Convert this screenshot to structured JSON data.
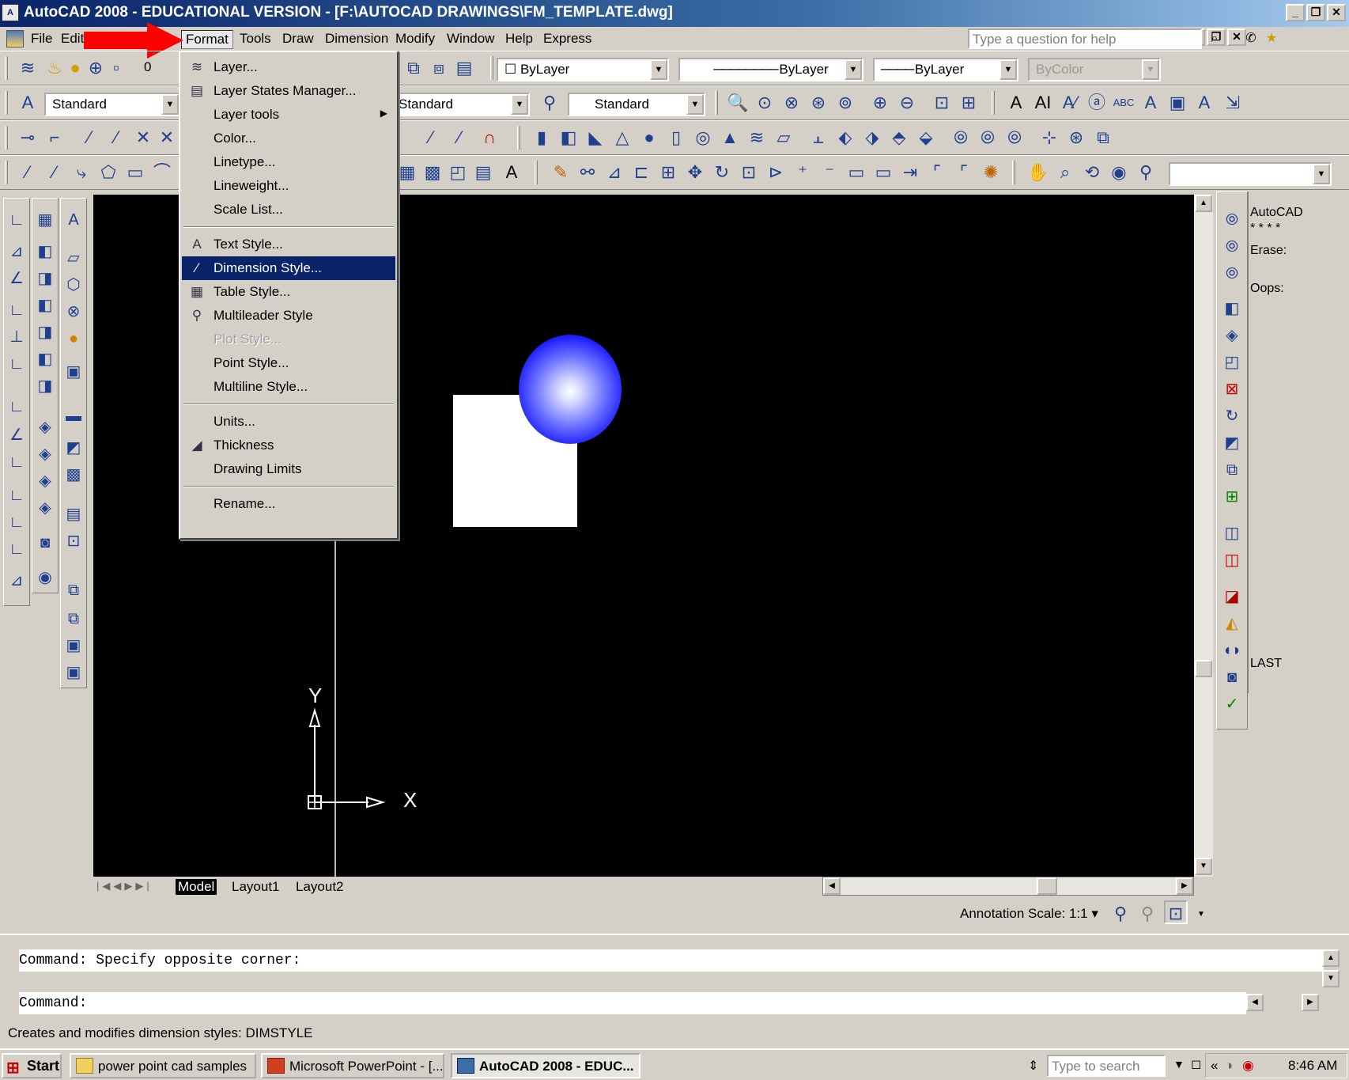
{
  "window": {
    "title": "AutoCAD 2008 - EDUCATIONAL VERSION - [F:\\AUTOCAD DRAWINGS\\FM_TEMPLATE.dwg]",
    "app_icon": "autocad-icon"
  },
  "menubar": {
    "items": [
      {
        "label": "File"
      },
      {
        "label": "Edit"
      },
      {
        "label": "Format"
      },
      {
        "label": "Tools"
      },
      {
        "label": "Draw"
      },
      {
        "label": "Dimension"
      },
      {
        "label": "Modify"
      },
      {
        "label": "Window"
      },
      {
        "label": "Help"
      },
      {
        "label": "Express"
      }
    ],
    "active": "Format",
    "help_placeholder": "Type a question for help"
  },
  "toolbars": {
    "layer_value": "0",
    "color_combo": "ByLayer",
    "linetype_combo": "ByLayer",
    "lineweight_combo": "ByLayer",
    "plotstyle_combo": "ByColor",
    "text_style": "Standard",
    "dim_style": "Standard",
    "table_style": "Standard"
  },
  "format_menu": {
    "items": [
      {
        "label": "Layer...",
        "icon": "layer-icon"
      },
      {
        "label": "Layer States Manager...",
        "icon": "layer-states-icon"
      },
      {
        "label": "Layer tools",
        "submenu": true
      },
      {
        "label": "Color..."
      },
      {
        "label": "Linetype..."
      },
      {
        "label": "Lineweight..."
      },
      {
        "label": "Scale List..."
      },
      {
        "label": "Text Style...",
        "icon": "text-style-icon"
      },
      {
        "label": "Dimension Style...",
        "icon": "dimension-style-icon",
        "highlighted": true
      },
      {
        "label": "Table Style...",
        "icon": "table-style-icon"
      },
      {
        "label": "Multileader Style",
        "icon": "multileader-icon"
      },
      {
        "label": "Plot Style...",
        "disabled": true
      },
      {
        "label": "Point Style..."
      },
      {
        "label": "Multiline Style..."
      },
      {
        "label": "Units..."
      },
      {
        "label": "Thickness",
        "icon": "thickness-icon"
      },
      {
        "label": "Drawing Limits"
      },
      {
        "label": "Rename..."
      }
    ]
  },
  "canvas": {
    "background": "#000000",
    "ucs_x": "X",
    "ucs_y": "Y"
  },
  "tabs": [
    "Model",
    "Layout1",
    "Layout2"
  ],
  "annotation": {
    "label": "Annotation Scale:",
    "value": "1:1"
  },
  "command_history": [
    "AutoCAD",
    "* * * *",
    "Erase:",
    "Oops:",
    "LAST"
  ],
  "command_window": {
    "line1": "Command: Specify opposite corner:",
    "line2": "Command:"
  },
  "status_text": "Creates and modifies dimension styles:  DIMSTYLE",
  "taskbar": {
    "start": "Start",
    "tasks": [
      {
        "label": "power point cad samples"
      },
      {
        "label": "Microsoft PowerPoint - [..."
      },
      {
        "label": "AutoCAD 2008 - EDUC..."
      }
    ],
    "search_placeholder": "Type to search",
    "time": "8:46 AM"
  }
}
